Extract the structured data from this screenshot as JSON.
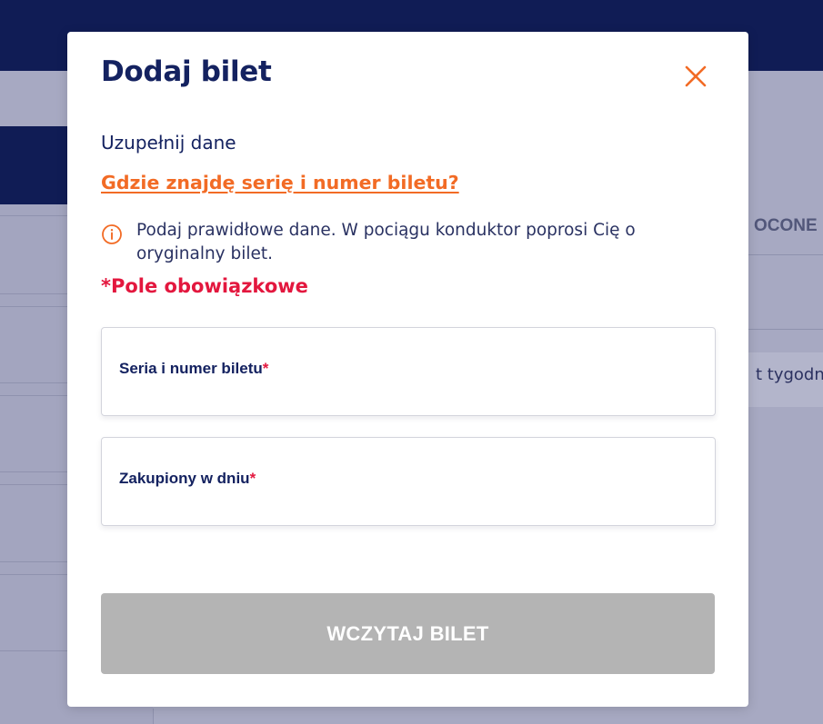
{
  "background": {
    "tab_label": "OCONE",
    "card_text": "t tygodnia"
  },
  "modal": {
    "title": "Dodaj bilet",
    "close_icon": "close-icon",
    "subtitle": "Uzupełnij dane",
    "help_link": "Gdzie znajdę serię i numer biletu?",
    "info_icon": "info-circle-icon",
    "info_text": "Podaj prawidłowe dane. W pociągu konduktor poprosi Cię o oryginalny bilet.",
    "required_note": "*Pole obowiązkowe",
    "fields": [
      {
        "label": "Seria i numer biletu",
        "required_mark": "*",
        "value": ""
      },
      {
        "label": "Zakupiony w dniu",
        "required_mark": "*",
        "value": ""
      }
    ],
    "submit_label": "WCZYTAJ BILET"
  },
  "colors": {
    "brand_navy": "#142260",
    "accent_orange": "#f26b25",
    "required_red": "#e3173e",
    "button_disabled": "#b4b4b4",
    "overlay": "#a7a9c2"
  }
}
